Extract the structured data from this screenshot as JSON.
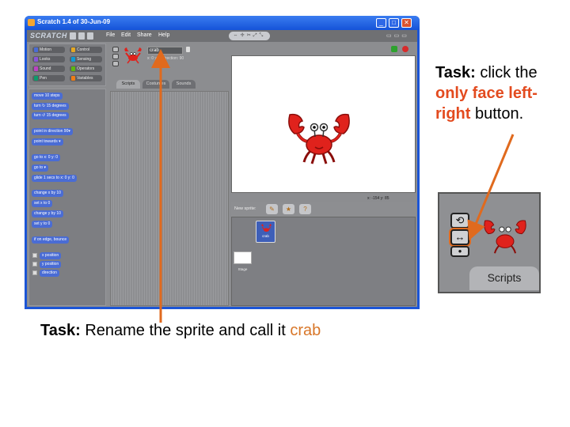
{
  "window": {
    "title": "Scratch 1.4 of 30-Jun-09",
    "controls": [
      "_",
      "□",
      "✕"
    ]
  },
  "menubar": {
    "logo": "SCRATCH",
    "menus": [
      "File",
      "Edit",
      "Share",
      "Help"
    ],
    "tools": "⇔✢✂⤢⤡",
    "view_buttons": "▭▭▭"
  },
  "categories": [
    {
      "label": "Motion",
      "color": "#4a6cd4"
    },
    {
      "label": "Control",
      "color": "#e6a822"
    },
    {
      "label": "Looks",
      "color": "#8a55d7"
    },
    {
      "label": "Sensing",
      "color": "#0e9ad4"
    },
    {
      "label": "Sound",
      "color": "#bb42c3"
    },
    {
      "label": "Operators",
      "color": "#5cb712"
    },
    {
      "label": "Pen",
      "color": "#0e9a6c"
    },
    {
      "label": "Variables",
      "color": "#ee7d16"
    }
  ],
  "blocks": [
    "move 10 steps",
    "turn ↻ 15 degrees",
    "turn ↺ 15 degrees",
    "point in direction 90▾",
    "point towards ▾",
    "go to x: 0 y: 0",
    "go to ▾",
    "glide 1 secs to x: 0 y: 0",
    "change x by 10",
    "set x to 0",
    "change y by 10",
    "set y to 0",
    "if on edge, bounce"
  ],
  "reporters": [
    "x position",
    "y position",
    "direction"
  ],
  "sprite": {
    "name": "crab",
    "coords": "x: 0   y: 0   direction: 90"
  },
  "tabs": [
    "Scripts",
    "Costumes",
    "Sounds"
  ],
  "stage": {
    "coords": "x: -154  y: 85"
  },
  "sprite_panel": {
    "label": "New sprite:",
    "thumb_label": "crab",
    "stage_label": "Stage"
  },
  "annotations": {
    "right": {
      "prefix": "Task:",
      "text1": " click the ",
      "highlight": "only face left-right",
      "text2": " button."
    },
    "bottom": {
      "prefix": "Task:",
      "text": " Rename the sprite and call it ",
      "highlight": "crab"
    }
  },
  "zoom": {
    "tab_label": "Scripts"
  },
  "colors": {
    "highlight_red": "#e34b1f",
    "highlight_orange": "#d87628",
    "arrow_orange": "#e06a1e",
    "crab_red": "#e0221c"
  }
}
